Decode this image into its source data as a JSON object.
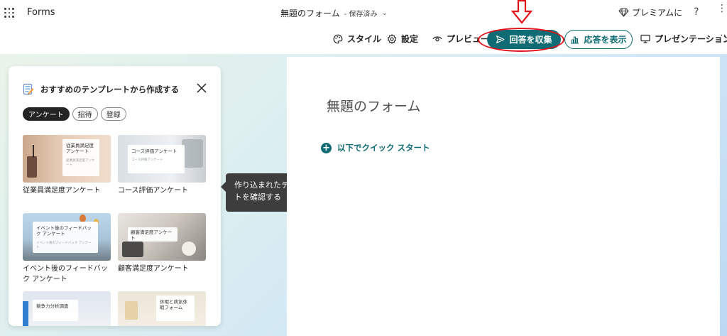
{
  "app": {
    "name": "Forms"
  },
  "document": {
    "title": "無題のフォーム",
    "save_status": "- 保存済み"
  },
  "header": {
    "premium_label": "プレミアムに",
    "help_label": "?"
  },
  "toolbar": {
    "style_label": "スタイル",
    "settings_label": "設定",
    "preview_label": "プレビュー",
    "collect_label": "回答を収集",
    "view_responses_label": "応答を表示",
    "present_label": "プレゼンテーション"
  },
  "template_panel": {
    "title": "おすすめのテンプレートから作成する",
    "chips": [
      "アンケート",
      "招待",
      "登録"
    ],
    "templates": [
      {
        "label": "従業員満足度アンケート",
        "card_title": "従業員満足度アンケート",
        "card_sub": "従業員満足度アンケート"
      },
      {
        "label": "コース評価アンケート",
        "card_title": "コース評価アンケート",
        "card_sub": "コース評価アンケート"
      },
      {
        "label": "イベント後のフィードバック アンケート",
        "card_title": "イベント後のフィードバック アンケート",
        "card_sub": "イベント後のフィードバック アンケート"
      },
      {
        "label": "顧客満足度アンケート",
        "card_title": "顧客満足度アンケート",
        "card_sub": ""
      },
      {
        "label": "",
        "card_title": "競争力分析調査",
        "card_sub": ""
      },
      {
        "label": "",
        "card_title": "休暇と病気休暇フォーム",
        "card_sub": ""
      }
    ]
  },
  "tooltip": {
    "text": "作り込まれたテンプレートを確認する"
  },
  "form": {
    "title": "無題のフォーム",
    "quick_start_label": "以下でクイック スタート"
  },
  "colors": {
    "accent": "#0f6c74",
    "annotation": "#e3111a",
    "tooltip_bg": "#3d3d3d"
  }
}
